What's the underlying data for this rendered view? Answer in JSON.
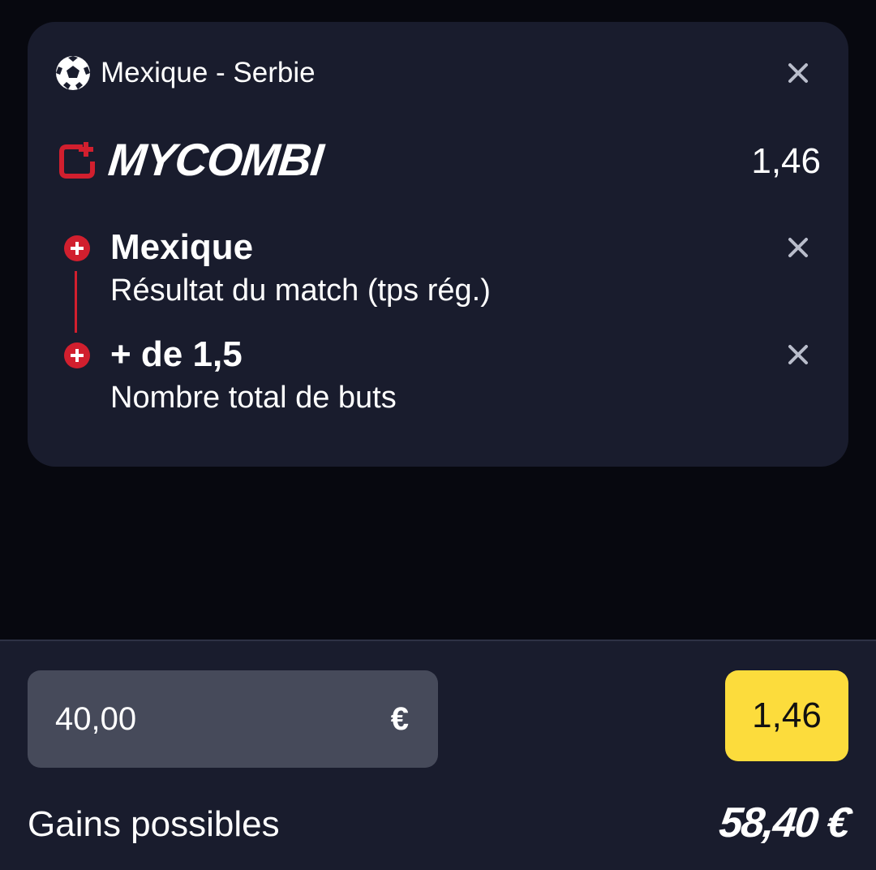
{
  "bet_card": {
    "match_title": "Mexique - Serbie",
    "sport_icon": "soccer-ball-icon",
    "combi_label": "MYCOMBI",
    "combi_icon": "mycombi-logo-icon",
    "combi_odds": "1,46",
    "selections": [
      {
        "name": "Mexique",
        "market": "Résultat du match (tps rég.)"
      },
      {
        "name": "+ de 1,5",
        "market": "Nombre total de buts"
      }
    ]
  },
  "stake": {
    "value": "40,00",
    "currency": "€"
  },
  "odds_button": {
    "label": "1,46"
  },
  "gains": {
    "label": "Gains possibles",
    "value": "58,40 €"
  },
  "colors": {
    "background": "#07080f",
    "card": "#191c2d",
    "accent_red": "#d11f2e",
    "odds_yellow": "#fcdc3c",
    "stake_field": "#464a5a",
    "close_icon": "#b9bdcb"
  }
}
